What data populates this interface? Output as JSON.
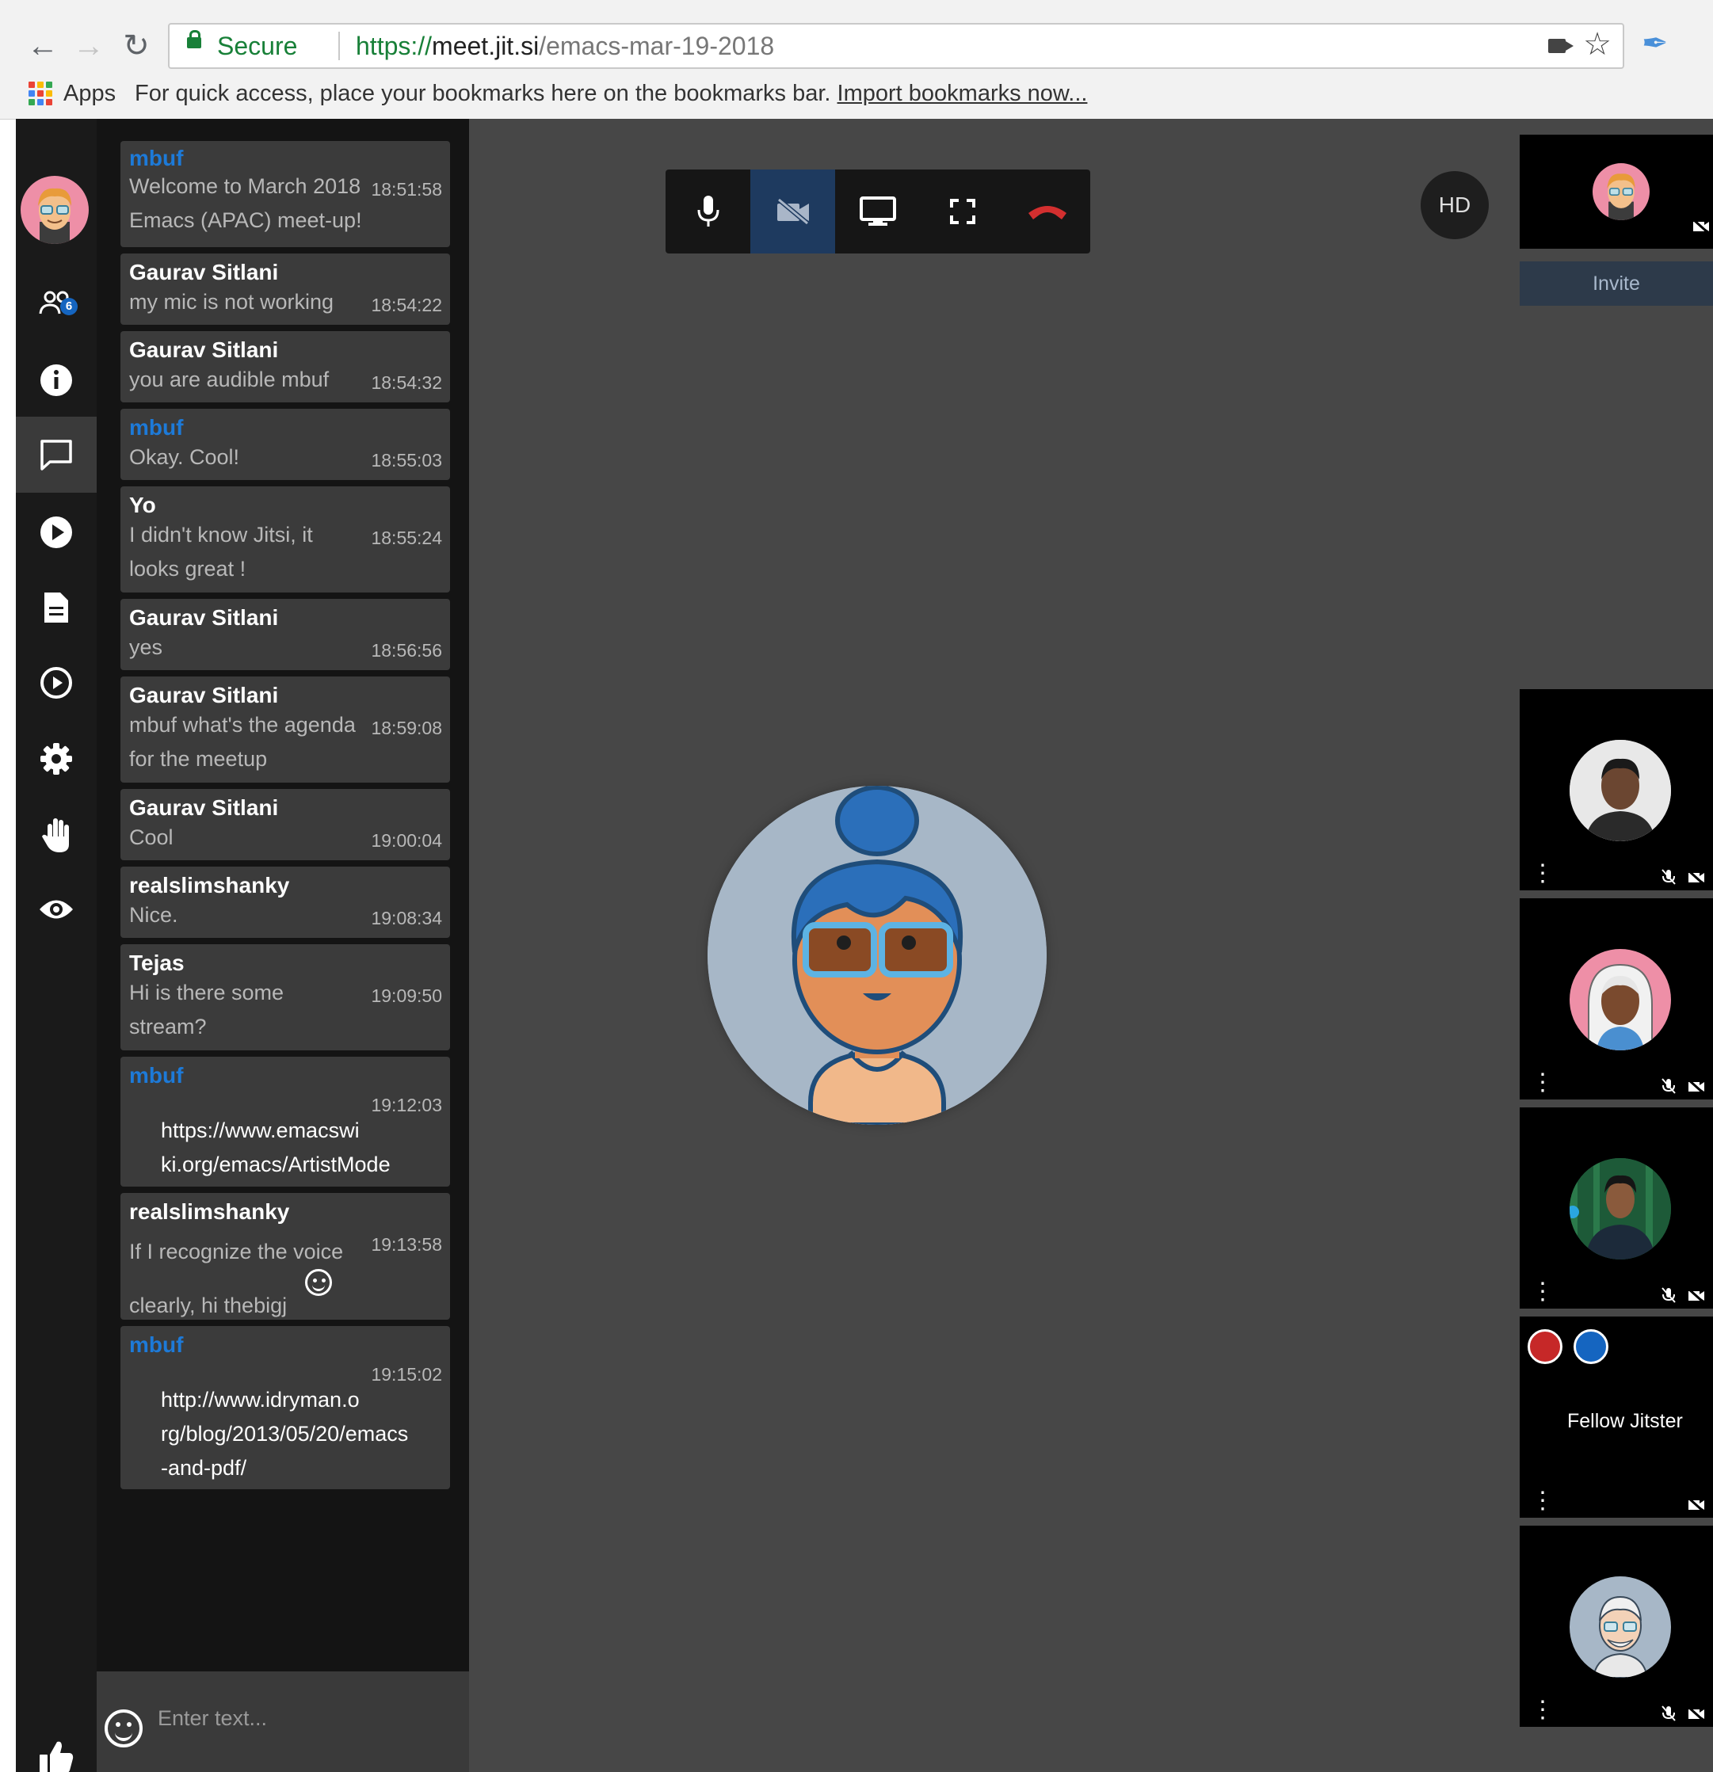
{
  "browser": {
    "secure_label": "Secure",
    "url_scheme": "https://",
    "url_host": "meet.jit.si",
    "url_path": "/emacs-mar-19-2018",
    "bookmarks_apps": "Apps",
    "bookmarks_hint": "For quick access, place your bookmarks here on the bookmarks bar.",
    "bookmarks_import": "Import bookmarks now..."
  },
  "sidebar": {
    "participants_count": "6"
  },
  "chat": {
    "messages": [
      {
        "name": "mbuf",
        "text": "Welcome to March 2018\nEmacs (APAC) meet-up!",
        "time": "18:51:58"
      },
      {
        "name": "Gaurav Sitlani",
        "text": "my mic is not working",
        "time": "18:54:22"
      },
      {
        "name": "Gaurav Sitlani",
        "text": "you are audible mbuf",
        "time": "18:54:32"
      },
      {
        "name": "mbuf",
        "text": "Okay. Cool!",
        "time": "18:55:03"
      },
      {
        "name": "Yo",
        "text": "I didn't know Jitsi, it\nlooks great !",
        "time": "18:55:24"
      },
      {
        "name": "Gaurav Sitlani",
        "text": "yes",
        "time": "18:56:56"
      },
      {
        "name": "Gaurav Sitlani",
        "text": "mbuf what's the agenda\nfor the meetup",
        "time": "18:59:08"
      },
      {
        "name": "Gaurav Sitlani",
        "text": "Cool",
        "time": "19:00:04"
      },
      {
        "name": "realslimshanky",
        "text": "Nice.",
        "time": "19:08:34"
      },
      {
        "name": "Tejas",
        "text": "Hi is there some\nstream?",
        "time": "19:09:50"
      },
      {
        "name": "mbuf",
        "text": "https://www.emacswi\nki.org/emacs/ArtistMode",
        "time": "19:12:03"
      },
      {
        "name": "realslimshanky",
        "text": "If I recognize the voice\nclearly, hi thebigj",
        "time": "19:13:58"
      },
      {
        "name": "mbuf",
        "text": "http://www.idryman.o\nrg/blog/2013/05/20/emacs\n-and-pdf/",
        "time": "19:15:02"
      }
    ],
    "input_placeholder": "Enter text..."
  },
  "stage": {
    "hd_label": "HD",
    "invite_label": "Invite",
    "fellow_label": "Fellow Jitster"
  },
  "colors": {
    "accent": "#1d7ad8",
    "hangup": "#d32f2f",
    "stage_bg": "#474747",
    "sidebar_bg": "#1a1a1a",
    "chat_bg": "#141414",
    "bubble_bg": "#3b3b3b"
  }
}
